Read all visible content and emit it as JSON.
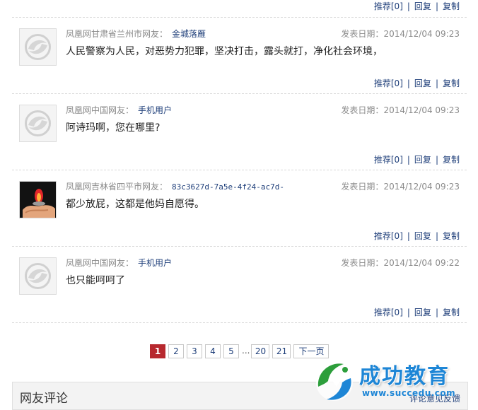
{
  "actions": {
    "recommend": "推荐",
    "count_prefix": "[",
    "count_suffix": "]",
    "reply": "回复",
    "copy": "复制",
    "separator": "|"
  },
  "top_actions": {
    "count": "0"
  },
  "comments": [
    {
      "location": "凤凰网甘肃省兰州市网友：",
      "user": "金城落雁",
      "date_label": "发表日期：",
      "date": "2014/12/04 09:23",
      "text": "人民警察为人民，对恶势力犯罪，坚决打击，露头就打，净化社会环境，",
      "count": "0",
      "avatar": "phoenix-icon"
    },
    {
      "location": "凤凰网中国网友：",
      "user": "手机用户",
      "date_label": "发表日期：",
      "date": "2014/12/04 09:23",
      "text": "阿诗玛啊，您在哪里?",
      "count": "0",
      "avatar": "phoenix-icon"
    },
    {
      "location": "凤凰网吉林省四平市网友：",
      "user": "83c3627d-7a5e-4f24-ac7d-",
      "date_label": "发表日期：",
      "date": "2014/12/04 09:23",
      "text": "都少放屁，这都是他妈自愿得。",
      "count": "0",
      "avatar": "photo-avatar"
    },
    {
      "location": "凤凰网中国网友：",
      "user": "手机用户",
      "date_label": "发表日期：",
      "date": "2014/12/04 09:22",
      "text": "也只能呵呵了",
      "count": "0",
      "avatar": "phoenix-icon"
    }
  ],
  "pagination": {
    "pages": [
      "1",
      "2",
      "3",
      "4",
      "5"
    ],
    "ellipsis": "...",
    "tail": [
      "20",
      "21"
    ],
    "next": "下一页",
    "current": "1"
  },
  "section": {
    "title": "网友评论",
    "link": "评论意见反馈"
  },
  "watermark": {
    "brand": "成功教育",
    "url": "www.succedu.com"
  },
  "colors": {
    "link": "#1f3f7a",
    "current_page": "#b7282e",
    "brand": "#1e86d6"
  }
}
